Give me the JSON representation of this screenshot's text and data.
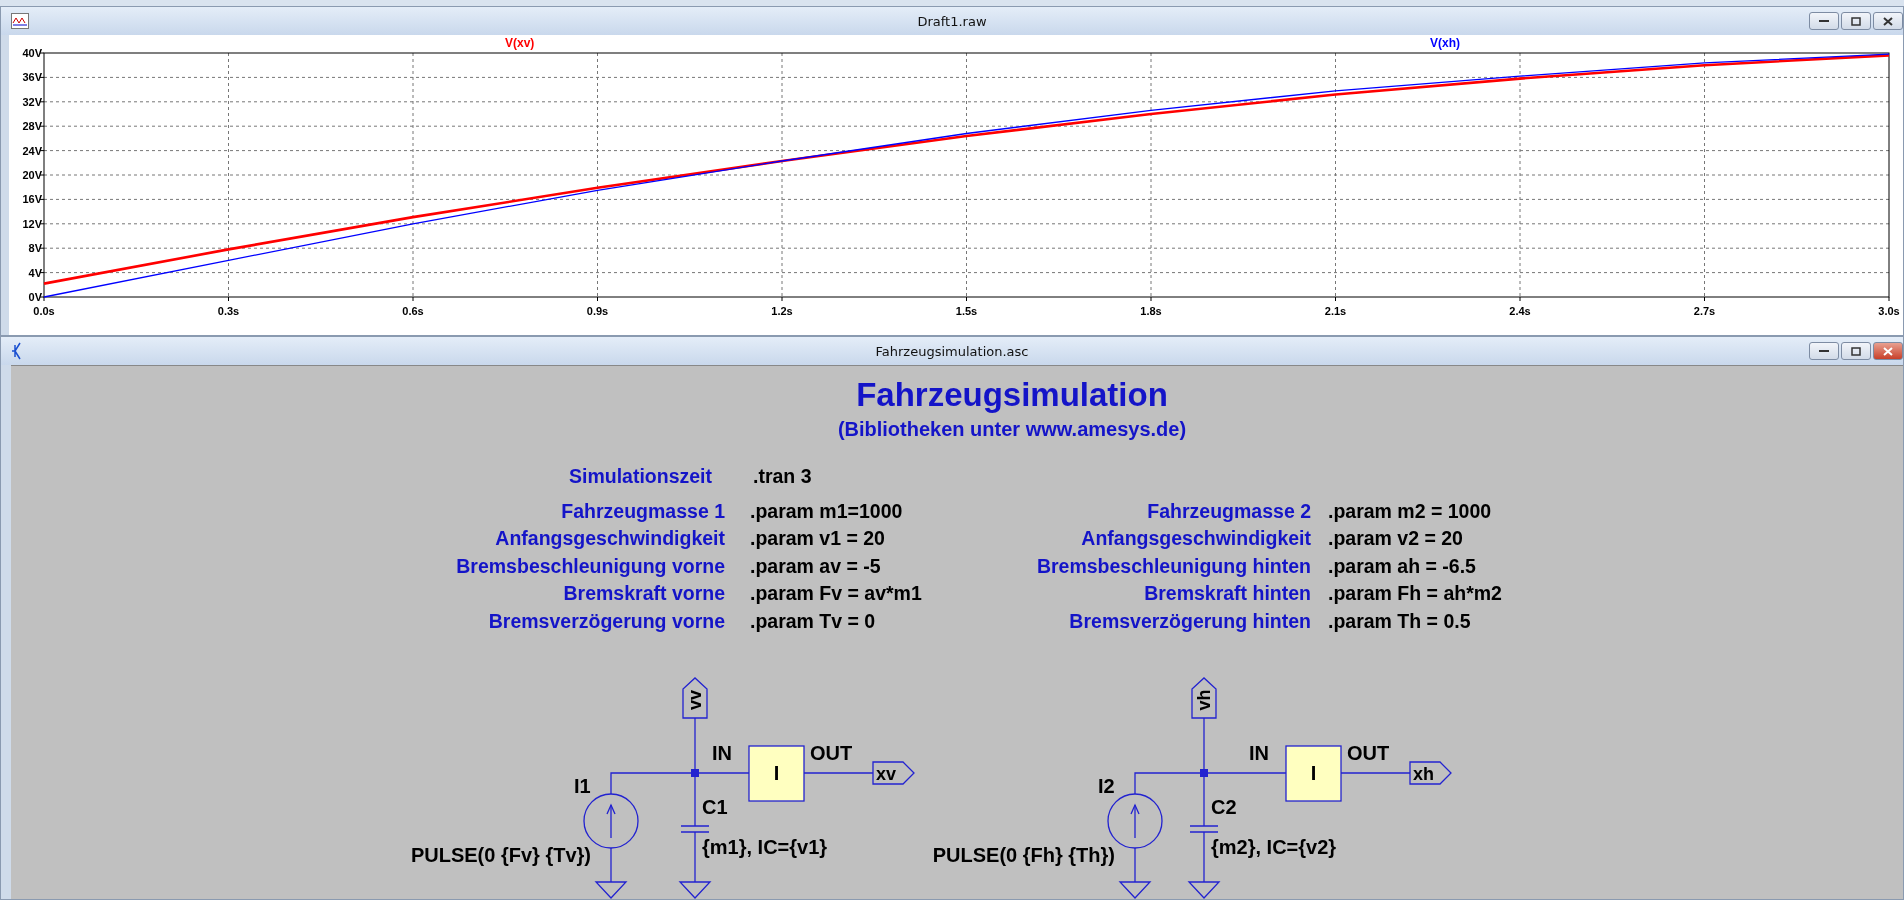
{
  "waveform_window": {
    "title": "Draft1.raw",
    "chart_data": {
      "type": "line",
      "x": [
        0,
        0.3,
        0.6,
        0.9,
        1.2,
        1.5,
        1.8,
        2.1,
        2.4,
        2.7,
        3.0
      ],
      "series": [
        {
          "name": "V(xv)",
          "color": "#ff0000",
          "values": [
            2.2,
            7.8,
            13.1,
            17.9,
            22.3,
            26.4,
            30.0,
            33.2,
            35.8,
            38.0,
            39.6
          ]
        },
        {
          "name": "V(xh)",
          "color": "#0000ff",
          "values": [
            0,
            6.0,
            12.0,
            17.5,
            22.3,
            26.8,
            30.6,
            33.8,
            36.2,
            38.4,
            39.8
          ]
        }
      ],
      "xlim": [
        0,
        3
      ],
      "ylim": [
        0,
        40
      ],
      "grid": true,
      "xticks": [
        {
          "value": 0,
          "label": "0.0s"
        },
        {
          "value": 0.3,
          "label": "0.3s"
        },
        {
          "value": 0.6,
          "label": "0.6s"
        },
        {
          "value": 0.9,
          "label": "0.9s"
        },
        {
          "value": 1.2,
          "label": "1.2s"
        },
        {
          "value": 1.5,
          "label": "1.5s"
        },
        {
          "value": 1.8,
          "label": "1.8s"
        },
        {
          "value": 2.1,
          "label": "2.1s"
        },
        {
          "value": 2.4,
          "label": "2.4s"
        },
        {
          "value": 2.7,
          "label": "2.7s"
        },
        {
          "value": 3.0,
          "label": "3.0s"
        }
      ],
      "yticks": [
        {
          "value": 0,
          "label": "0V"
        },
        {
          "value": 4,
          "label": "4V"
        },
        {
          "value": 8,
          "label": "8V"
        },
        {
          "value": 12,
          "label": "12V"
        },
        {
          "value": 16,
          "label": "16V"
        },
        {
          "value": 20,
          "label": "20V"
        },
        {
          "value": 24,
          "label": "24V"
        },
        {
          "value": 28,
          "label": "28V"
        },
        {
          "value": 32,
          "label": "32V"
        },
        {
          "value": 36,
          "label": "36V"
        },
        {
          "value": 40,
          "label": "40V"
        }
      ]
    }
  },
  "schematic_window": {
    "title": "Fahrzeugsimulation.asc",
    "heading": "Fahrzeugsimulation",
    "subtitle": "(Bibliotheken unter www.amesys.de)",
    "simulation": {
      "label": "Simulationszeit",
      "value": ".tran 3"
    },
    "front_params": [
      {
        "label": "Fahrzeugmasse 1",
        "value": ".param m1=1000"
      },
      {
        "label": "Anfangsgeschwindigkeit",
        "value": ".param v1 = 20"
      },
      {
        "label": "Bremsbeschleunigung vorne",
        "value": ".param av = -5"
      },
      {
        "label": "Bremskraft vorne",
        "value": ".param Fv = av*m1"
      },
      {
        "label": "Bremsverzögerung vorne",
        "value": ".param Tv = 0"
      }
    ],
    "rear_params": [
      {
        "label": "Fahrzeugmasse 2",
        "value": ".param m2 = 1000"
      },
      {
        "label": "Anfangsgeschwindigkeit",
        "value": ".param v2 = 20"
      },
      {
        "label": "Bremsbeschleunigung hinten",
        "value": ".param ah = -6.5"
      },
      {
        "label": "Bremskraft hinten",
        "value": ".param Fh = ah*m2"
      },
      {
        "label": "Bremsverzögerung hinten",
        "value": ".param Th = 0.5"
      }
    ],
    "circuits": [
      {
        "input_flag": "vv",
        "in_pin": "IN",
        "block": "I",
        "out_pin": "OUT",
        "output_flag": "xv",
        "source_name": "I1",
        "source_value": "PULSE(0 {Fv} {Tv})",
        "cap_name": "C1",
        "cap_value": "{m1}, IC={v1}"
      },
      {
        "input_flag": "vh",
        "in_pin": "IN",
        "block": "I",
        "out_pin": "OUT",
        "output_flag": "xh",
        "source_name": "I2",
        "source_value": "PULSE(0 {Fh} {Th})",
        "cap_name": "C2",
        "cap_value": "{m2}, IC={v2}"
      }
    ]
  }
}
